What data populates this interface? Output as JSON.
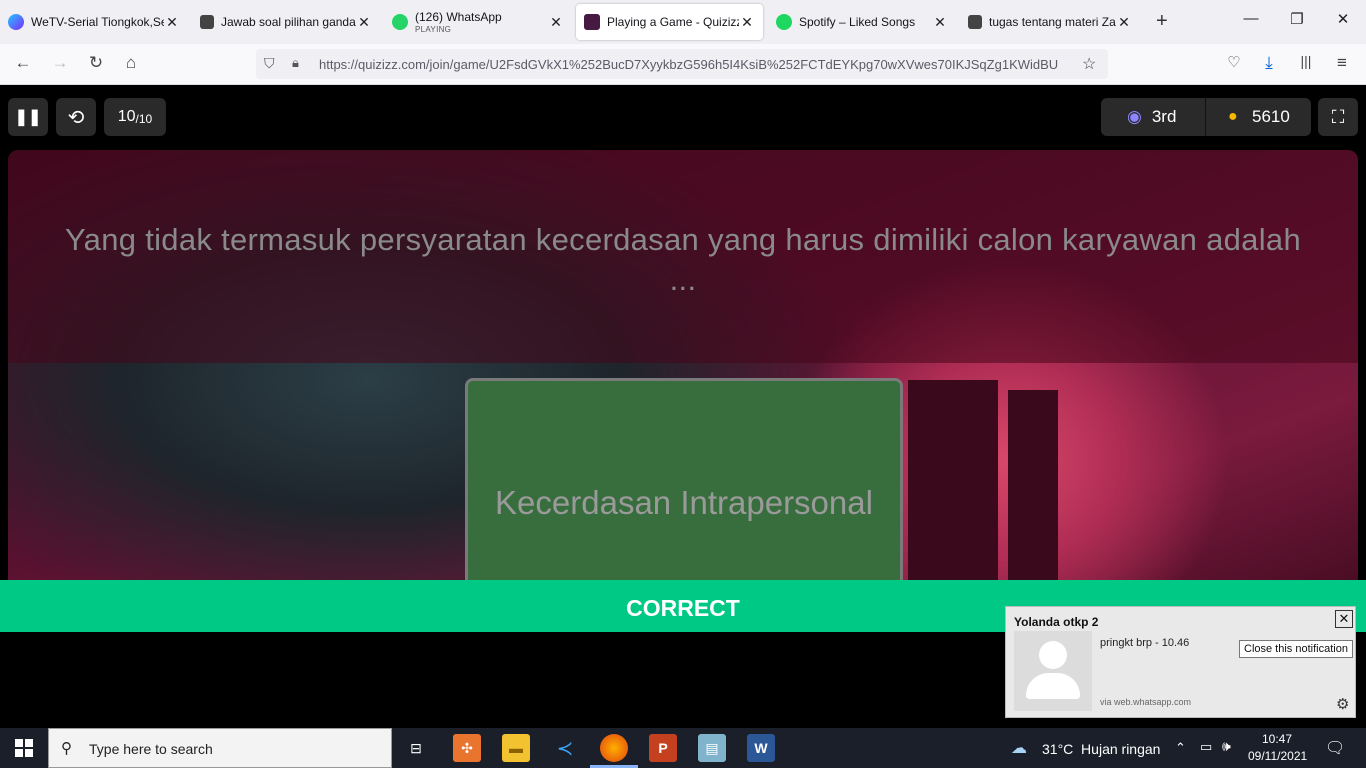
{
  "browser": {
    "tabs": [
      {
        "title": "WeTV-Serial Tiongkok,Se",
        "icon": "wetv-icon"
      },
      {
        "title": "Jawab soal pilihan ganda",
        "icon": "page-icon"
      },
      {
        "title": "(126) WhatsApp",
        "subtitle": "PLAYING",
        "icon": "whatsapp-icon"
      },
      {
        "title": "Playing a Game - Quizizz",
        "icon": "quizizz-icon"
      },
      {
        "title": "Spotify – Liked Songs",
        "icon": "spotify-icon"
      },
      {
        "title": "tugas tentang materi Zak",
        "icon": "page-icon"
      }
    ],
    "url": "https://quizizz.com/join/game/U2FsdGVkX1%252BucD7XyykbzG596h5I4KsiB%252FCTdEYKpg70wXVwes70IKJSqZg1KWidBU"
  },
  "game": {
    "progress": "10",
    "progress_total": "/10",
    "rank": "3rd",
    "coins": "5610",
    "question": "Yang tidak termasuk persyaratan kecerdasan yang harus dimiliki calon karyawan adalah ...",
    "answer": "Kecerdasan Intrapersonal",
    "result": "CORRECT"
  },
  "notification": {
    "sender": "Yolanda otkp 2",
    "message": "pringkt brp - 10.46",
    "source": "via web.whatsapp.com",
    "tooltip": "Close this notification"
  },
  "taskbar": {
    "search_placeholder": "Type here to search",
    "weather": "31°C  Hujan ringan",
    "time": "10:47",
    "date": "09/11/2021"
  },
  "colors": {
    "correct_bar": "#00c985",
    "answer_card": "#386e3d"
  }
}
